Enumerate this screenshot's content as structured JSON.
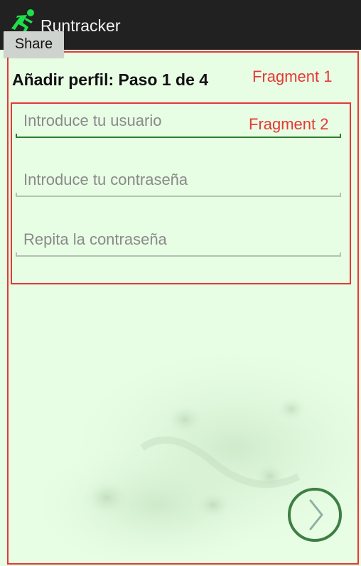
{
  "app": {
    "title": "Runtracker",
    "icon": "running-person-icon",
    "accent_color": "#1de04a",
    "toolbar_color": "#212121",
    "background_color": "#e7fde4"
  },
  "share_button": {
    "label": "Share"
  },
  "annotations": {
    "fragment1_label": "Fragment 1",
    "fragment2_label": "Fragment 2",
    "border_color": "#e53935"
  },
  "form": {
    "step_title": "Añadir perfil: Paso 1 de 4",
    "fields": [
      {
        "placeholder": "Introduce tu usuario",
        "value": "",
        "focused": true
      },
      {
        "placeholder": "Introduce tu contraseña",
        "value": "",
        "focused": false
      },
      {
        "placeholder": "Repita la contraseña",
        "value": "",
        "focused": false
      }
    ]
  },
  "next_button": {
    "icon": "chevron-right-icon",
    "color": "#3f7f44"
  }
}
